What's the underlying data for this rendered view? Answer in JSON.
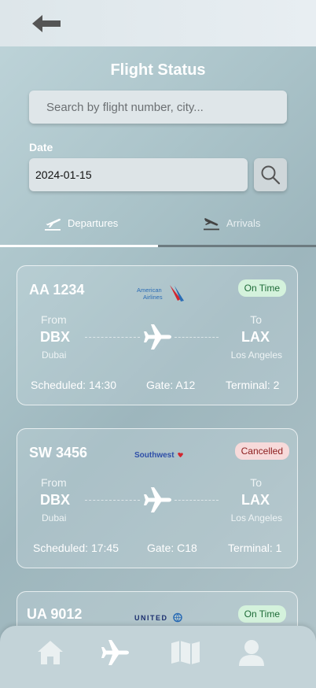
{
  "header": {
    "title": "Flight Status"
  },
  "search": {
    "placeholder": "Search by flight number, city..."
  },
  "date": {
    "label": "Date",
    "value": "2024-01-15"
  },
  "tabs": [
    {
      "label": "Departures",
      "active": true
    },
    {
      "label": "Arrivals",
      "active": false
    }
  ],
  "flights": [
    {
      "number": "AA 1234",
      "airline": "American Airlines",
      "airline_logo_text": [
        "American",
        "Airlines"
      ],
      "status": "On Time",
      "from_label": "From",
      "from_code": "DBX",
      "from_city": "Dubai",
      "to_label": "To",
      "to_code": "LAX",
      "to_city": "Los Angeles",
      "scheduled": "Scheduled: 14:30",
      "gate": "Gate: A12",
      "terminal": "Terminal: 2"
    },
    {
      "number": "SW 3456",
      "airline": "Southwest",
      "airline_logo_text": [
        "Southwest"
      ],
      "status": "Cancelled",
      "from_label": "From",
      "from_code": "DBX",
      "from_city": "Dubai",
      "to_label": "To",
      "to_code": "LAX",
      "to_city": "Los Angeles",
      "scheduled": "Scheduled: 17:45",
      "gate": "Gate: C18",
      "terminal": "Terminal: 1"
    },
    {
      "number": "UA 9012",
      "airline": "United",
      "airline_logo_text": [
        "UNITED"
      ],
      "status": "On Time"
    }
  ],
  "bottom_nav": [
    {
      "icon": "home-icon",
      "active": false
    },
    {
      "icon": "airplane-icon",
      "active": true
    },
    {
      "icon": "map-icon",
      "active": false
    },
    {
      "icon": "profile-icon",
      "active": false
    }
  ],
  "colors": {
    "status_on_time_bg": "#d4f2dc",
    "status_cancelled_bg": "#f7dada",
    "american_red": "#d2262f",
    "american_blue": "#2a6cb5",
    "southwest_blue": "#2f4fa8",
    "united_navy": "#1b2f6e"
  }
}
